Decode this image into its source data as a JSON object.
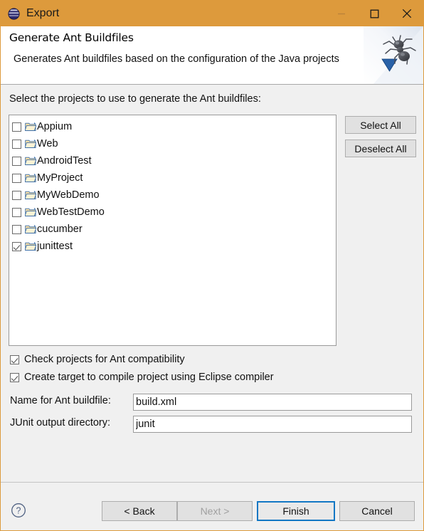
{
  "window": {
    "title": "Export",
    "app_icon": "eclipse-sphere-icon",
    "titlebar_color": "#dd9a3c",
    "controls": {
      "minimize": "minimize-icon",
      "maximize": "maximize-icon",
      "close": "close-icon"
    }
  },
  "header": {
    "title": "Generate Ant Buildfiles",
    "description": "Generates Ant buildfiles based on the configuration of the Java projects",
    "banner_icon": "ant-banner-image"
  },
  "main": {
    "intro_label": "Select the projects to use to generate the Ant buildfiles:",
    "projects": [
      {
        "name": "Appium",
        "checked": false,
        "icon": "folder-icon"
      },
      {
        "name": "Web",
        "checked": false,
        "icon": "folder-icon"
      },
      {
        "name": "AndroidTest",
        "checked": false,
        "icon": "folder-icon"
      },
      {
        "name": "MyProject",
        "checked": false,
        "icon": "folder-icon"
      },
      {
        "name": "MyWebDemo",
        "checked": false,
        "icon": "folder-icon"
      },
      {
        "name": "WebTestDemo",
        "checked": false,
        "icon": "folder-icon"
      },
      {
        "name": "cucumber",
        "checked": false,
        "icon": "folder-icon"
      },
      {
        "name": "junittest",
        "checked": true,
        "icon": "folder-icon"
      }
    ],
    "side_buttons": {
      "select_all": "Select All",
      "deselect_all": "Deselect All"
    },
    "options": [
      {
        "label": "Check projects for Ant compatibility",
        "checked": true
      },
      {
        "label": "Create target to compile project using Eclipse compiler",
        "checked": true
      }
    ],
    "fields": [
      {
        "label": "Name for Ant buildfile:",
        "value": "build.xml",
        "placeholder": ""
      },
      {
        "label": "JUnit output directory:",
        "value": "junit",
        "placeholder": ""
      }
    ]
  },
  "footer": {
    "help_icon": "help-question-icon",
    "buttons": {
      "back": "< Back",
      "next": "Next >",
      "finish": "Finish",
      "cancel": "Cancel"
    },
    "next_enabled": false,
    "finish_focused": true,
    "focus_color": "#1277c4"
  }
}
